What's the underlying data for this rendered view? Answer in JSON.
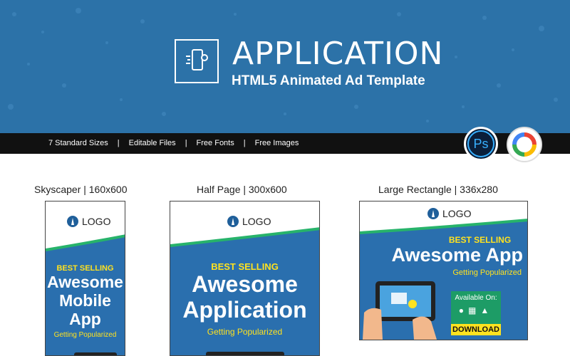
{
  "header": {
    "title": "APPLICATION",
    "subtitle": "HTML5 Animated Ad Template",
    "icon": "phone-settings-icon",
    "bg_color": "#2c72a8"
  },
  "features_bar": {
    "items": [
      "7 Standard Sizes",
      "Editable Files",
      "Free Fonts",
      "Free Images"
    ],
    "separator": "|",
    "badges": {
      "photoshop": "Ps",
      "google_web_designer": "google-web-designer-icon"
    }
  },
  "previews": [
    {
      "label": "Skyscaper | 160x600",
      "logo": "LOGO",
      "best": "BEST SELLING",
      "headline": [
        "Awesome",
        "Mobile",
        "App"
      ],
      "tagline": "Getting Popularized"
    },
    {
      "label": "Half Page | 300x600",
      "logo": "LOGO",
      "best": "BEST SELLING",
      "headline": [
        "Awesome",
        "Application"
      ],
      "tagline": "Getting Popularized"
    },
    {
      "label": "Large Rectangle | 336x280",
      "logo": "LOGO",
      "best": "BEST SELLING",
      "headline": [
        "Awesome App"
      ],
      "tagline": "Getting Popularized",
      "available": "Available On:",
      "download": "DOWNLOAD"
    }
  ],
  "colors": {
    "accent_yellow": "#ffe21f",
    "ad_blue": "#2a6fae",
    "green": "#1d9c66"
  }
}
